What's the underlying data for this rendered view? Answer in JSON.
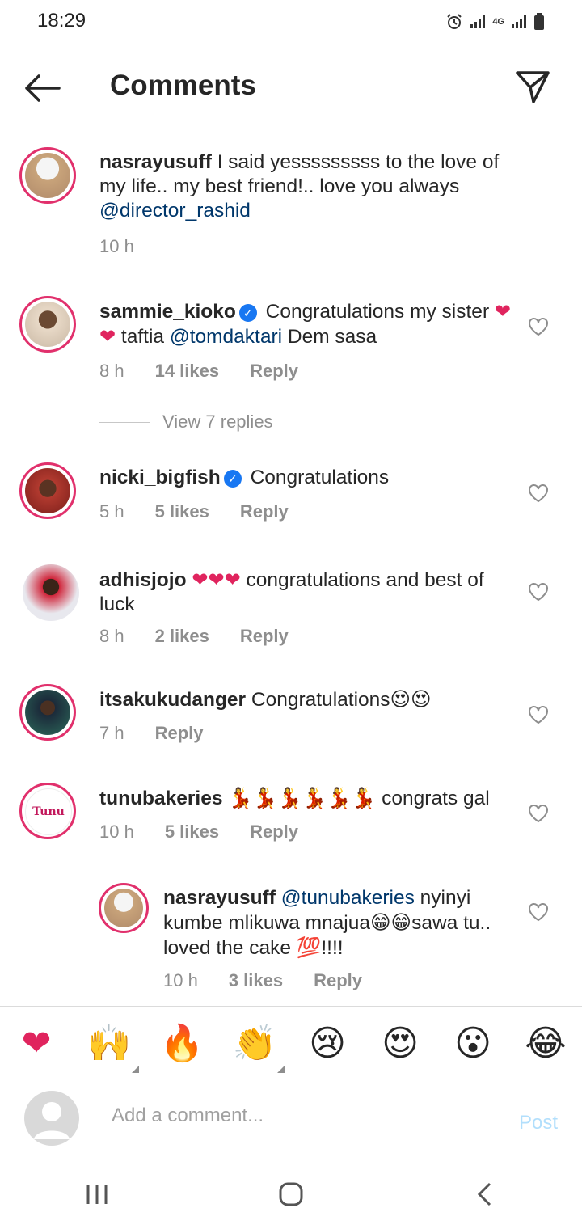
{
  "status": {
    "time": "18:29",
    "network": "4G"
  },
  "header": {
    "title": "Comments"
  },
  "caption": {
    "username": "nasrayusuff",
    "text": " I said yesssssssss to the love of my life.. my best friend!.. love you always ",
    "mention": "@director_rashid",
    "time": "10 h"
  },
  "comments": [
    {
      "username": "sammie_kioko",
      "verified": true,
      "text_before": " Congratulations my sister ",
      "emoji": "❤❤",
      "text_mid": " taftia ",
      "mention": "@tomdaktari",
      "text_after": " Dem sasa",
      "time": "8 h",
      "likes": "14 likes",
      "reply": "Reply"
    },
    {
      "username": "nicki_bigfish",
      "verified": true,
      "text": " Congratulations",
      "time": "5 h",
      "likes": "5 likes",
      "reply": "Reply"
    },
    {
      "username": "adhisjojo",
      "emoji": "❤❤❤",
      "text": " congratulations and best of luck",
      "time": "8 h",
      "likes": "2 likes",
      "reply": "Reply"
    },
    {
      "username": "itsakukudanger",
      "text": " Congratulations",
      "emoji": "😍😍",
      "time": "7 h",
      "reply": "Reply"
    },
    {
      "username": "tunubakeries",
      "emoji": "💃💃💃💃💃💃",
      "text": " congrats gal",
      "time": "10 h",
      "likes": "5 likes",
      "reply": "Reply",
      "avatar_text": "Tunu"
    },
    {
      "username": "nasrayusuff",
      "mention": "@tunubakeries",
      "text_a": " nyinyi kumbe mlikuwa mnajua",
      "emoji_a": "😁😁",
      "text_b": "sawa tu.. loved the cake ",
      "emoji_b": "💯",
      "text_c": "!!!!",
      "time": "10 h",
      "likes": "3 likes",
      "reply": "Reply"
    }
  ],
  "view_replies": "View 7 replies",
  "reactions": [
    "❤",
    "🙌",
    "🔥",
    "👏",
    "😢",
    "😍",
    "😮",
    "😂"
  ],
  "input": {
    "placeholder": "Add a comment...",
    "post_label": "Post"
  },
  "colors": {
    "accent": "#0095f6",
    "mention": "#00376b",
    "muted": "#8e8e8e",
    "heart": "#e0245e"
  }
}
